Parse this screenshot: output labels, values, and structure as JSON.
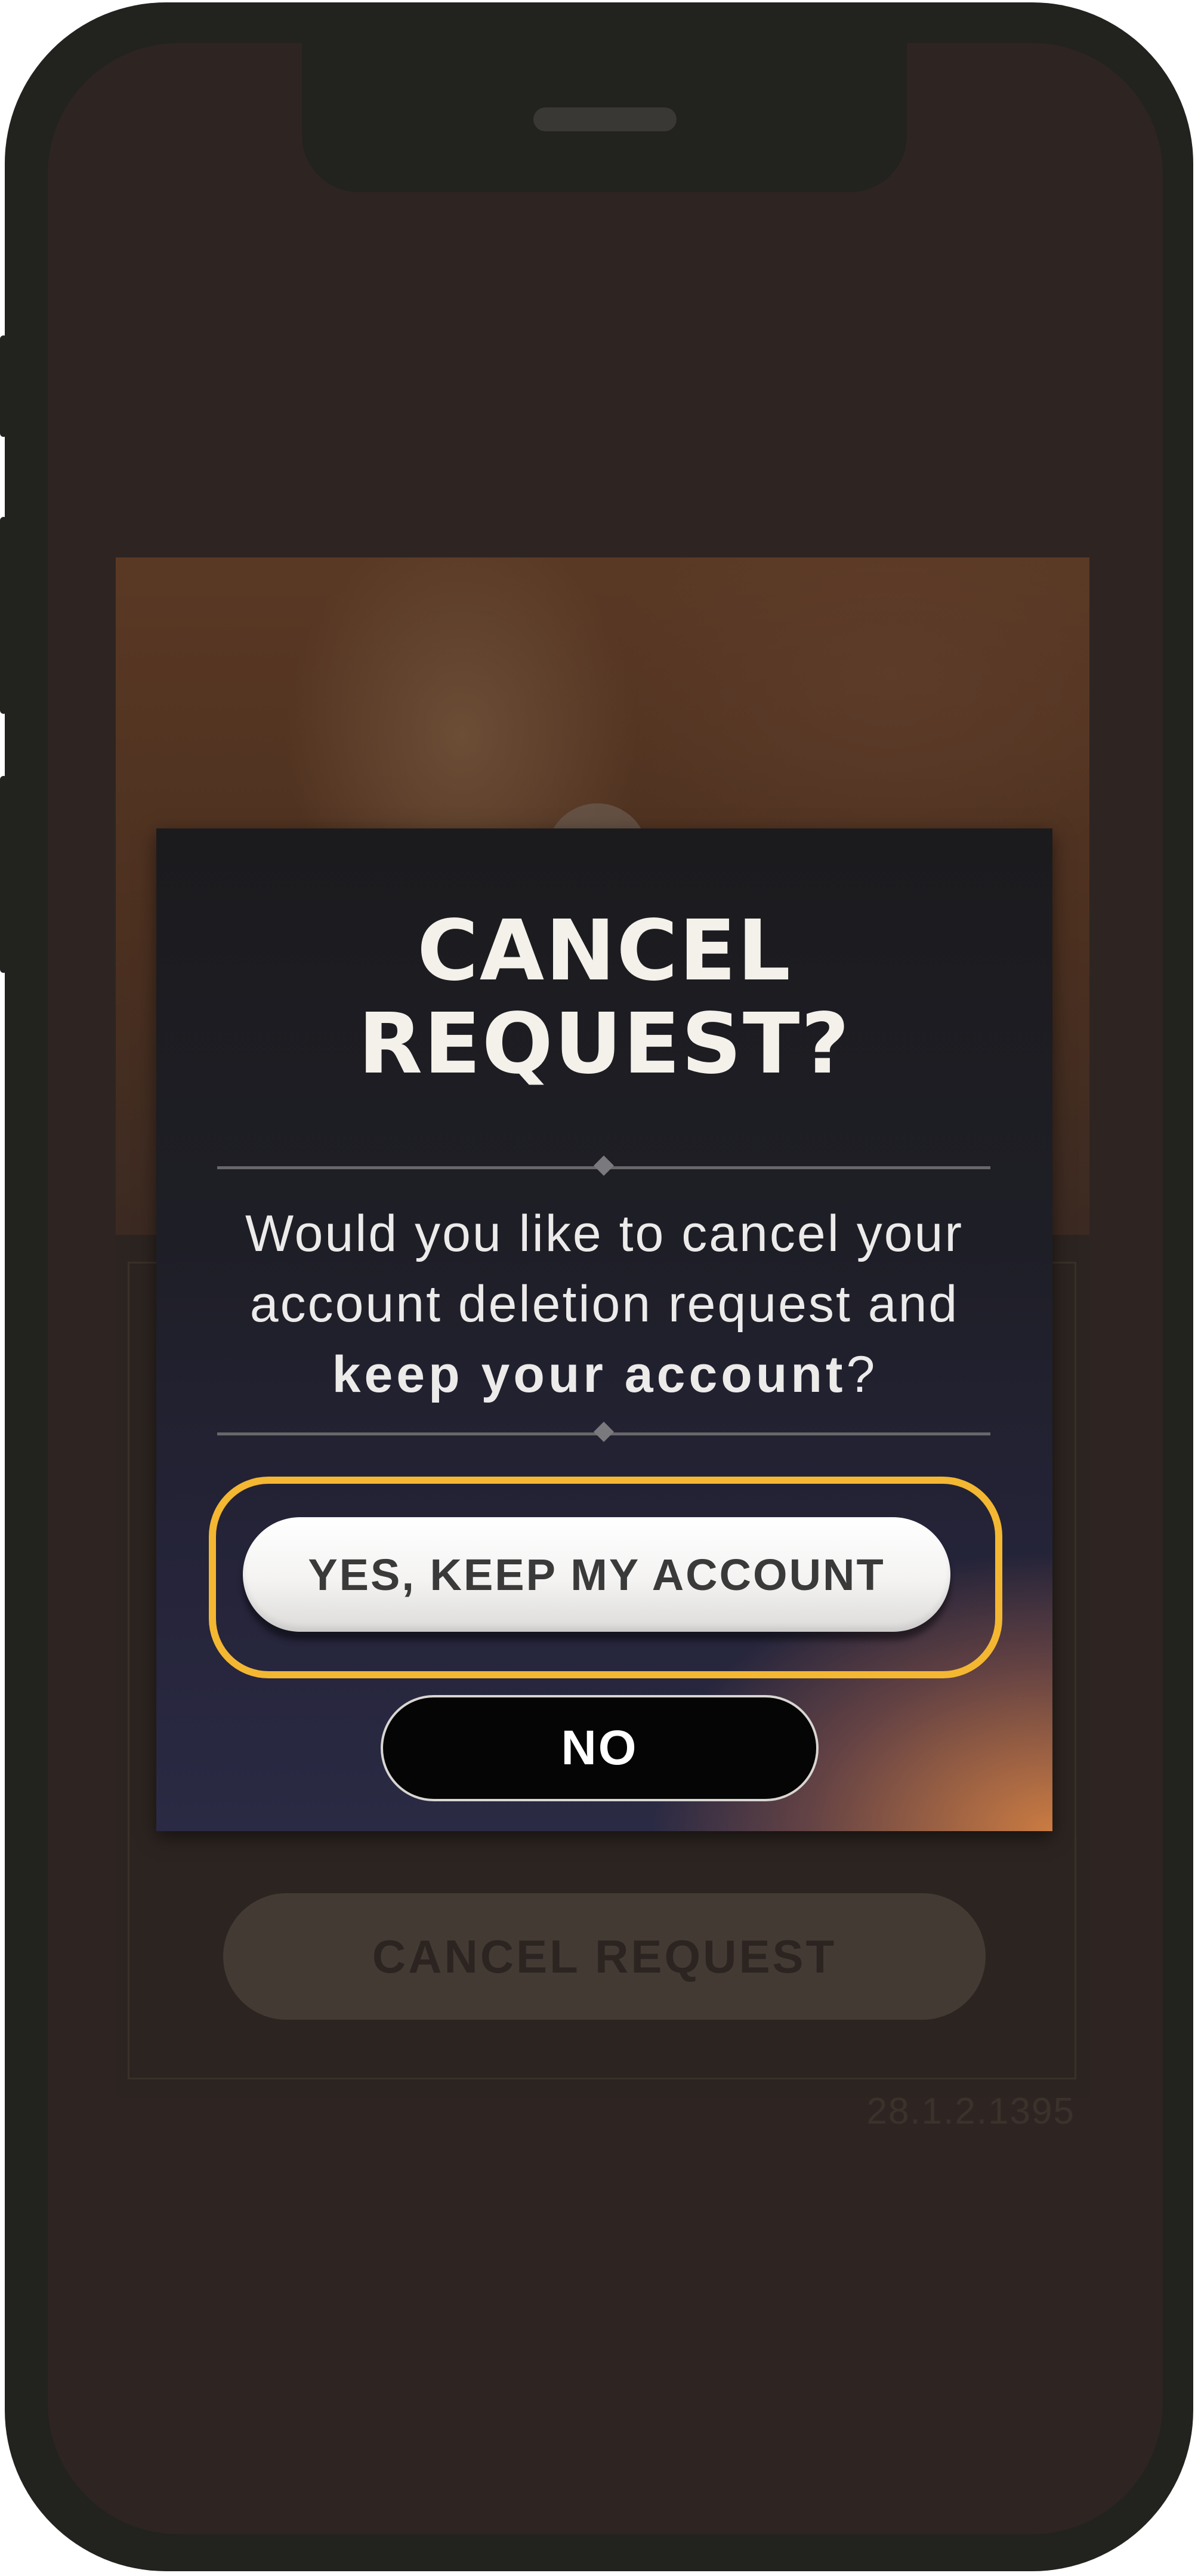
{
  "background_screen": {
    "cancel_request_label": "CANCEL REQUEST",
    "version": "28.1.2.1395"
  },
  "modal": {
    "title_line1": "CANCEL",
    "title_line2": "REQUEST?",
    "body_line1": "Would you like to cancel your",
    "body_line2": "account deletion request and",
    "body_line3_strong": "keep your account",
    "body_line3_suffix": "?",
    "yes_label": "YES, KEEP MY ACCOUNT",
    "no_label": "NO"
  },
  "colors": {
    "highlight": "#f4b731",
    "screen_background": "#2e2522",
    "phone_frame": "#22221f"
  }
}
